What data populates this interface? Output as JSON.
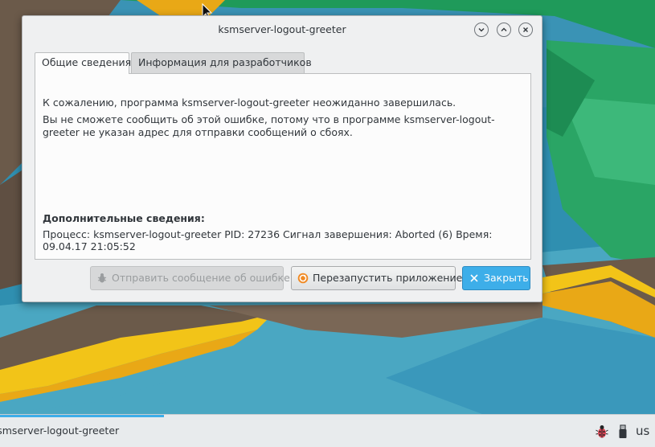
{
  "window": {
    "title": "ksmserver-logout-greeter",
    "controls": [
      "minimize-icon",
      "maximize-icon",
      "close-icon"
    ]
  },
  "tabs": [
    {
      "label": "Общие сведения",
      "active": true
    },
    {
      "label": "Информация для разработчиков",
      "active": false
    }
  ],
  "content": {
    "message": "К сожалению, программа ksmserver-logout-greeter неожиданно завершилась.",
    "explanation": "Вы не сможете сообщить об этой ошибке, потому что в программе ksmserver-logout-greeter не указан адрес для отправки сообщений о сбоях.",
    "details_heading": "Дополнительные сведения:",
    "details": "Процесс: ksmserver-logout-greeter PID: 27236 Сигнал завершения: Aborted (6) Время: 09.04.17 21:05:52"
  },
  "buttons": {
    "report": {
      "label": "Отправить сообщение об ошибке",
      "enabled": false,
      "icon": "bug-icon"
    },
    "restart": {
      "label": "Перезапустить приложение",
      "icon": "restart-icon"
    },
    "close": {
      "label": "Закрыть",
      "icon": "close-x-icon"
    }
  },
  "taskbar": {
    "task_label": "ksmserver-logout-greeter",
    "keyboard_layout": "us",
    "tray_icons": [
      "bug-tray-icon",
      "usb-icon"
    ]
  },
  "colors": {
    "accent": "#3daee9",
    "window_bg": "#eff0f1",
    "text": "#31363b"
  }
}
